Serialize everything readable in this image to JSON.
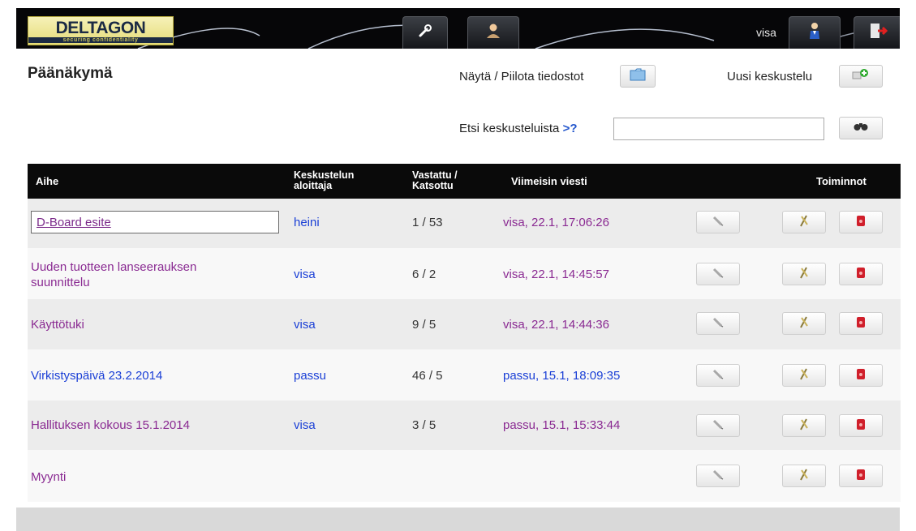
{
  "header": {
    "logo_text": "DELTAGON",
    "logo_tagline": "securing confidentiality",
    "username": "visa",
    "buttons": [
      {
        "name": "tools-tab",
        "icon": "wrench-icon"
      },
      {
        "name": "contacts-tab",
        "icon": "person-icon"
      },
      {
        "name": "profile-tab",
        "icon": "user-profile-icon"
      },
      {
        "name": "logout-tab",
        "icon": "logout-door-icon"
      }
    ]
  },
  "page": {
    "title": "Päänäkymä",
    "toggle_files_label": "Näytä / Piilota tiedostot",
    "new_discussion_label": "Uusi keskustelu",
    "search_label": "Etsi keskusteluista",
    "search_hint": ">?",
    "search_value": ""
  },
  "table": {
    "columns": {
      "topic": "Aihe",
      "starter_line1": "Keskustelun",
      "starter_line2": "aloittaja",
      "counts_line1": "Vastattu /",
      "counts_line2": "Katsottu",
      "last_message": "Viimeisin viesti",
      "actions": "Toiminnot"
    },
    "rows": [
      {
        "topic": "D-Board esite",
        "starter": "heini",
        "counts": "1 / 53",
        "last": "visa, 22.1, 17:06:26"
      },
      {
        "topic_line1": "Uuden tuotteen lanseerauksen",
        "topic_line2": "suunnittelu",
        "starter": "visa",
        "counts": "6 / 2",
        "last": "visa, 22.1, 14:45:57"
      },
      {
        "topic": "Käyttötuki",
        "starter": "visa",
        "counts": "9 / 5",
        "last": "visa, 22.1, 14:44:36"
      },
      {
        "topic": "Virkistyspäivä 23.2.2014",
        "starter": "passu",
        "counts": "46 / 5",
        "last": "passu, 15.1, 18:09:35"
      },
      {
        "topic": "Hallituksen kokous 15.1.2014",
        "starter": "visa",
        "counts": "3 / 5",
        "last": "passu, 15.1, 15:33:44"
      },
      {
        "topic": "Myynti",
        "starter": "",
        "counts": "",
        "last": ""
      }
    ]
  },
  "colors": {
    "header_bg": "#060608",
    "logo_bg": "#e5dc78",
    "table_header_bg": "#0a0a0a",
    "visited_link": "#8a2a92",
    "link_blue": "#1a3fd6",
    "delete_red": "#d01f2b"
  }
}
